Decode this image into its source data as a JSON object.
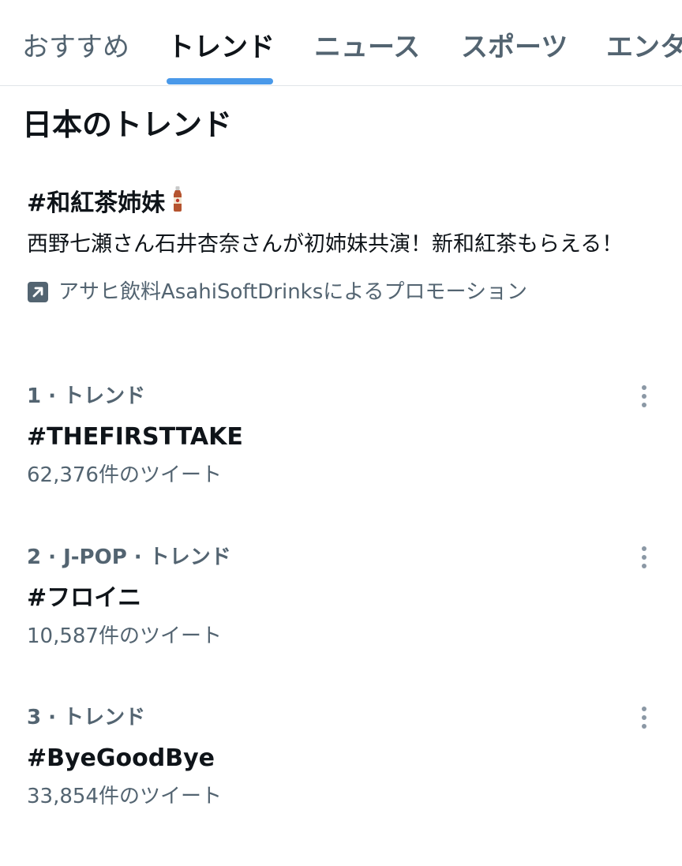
{
  "tabs": [
    {
      "label": "おすすめ"
    },
    {
      "label": "トレンド"
    },
    {
      "label": "ニュース"
    },
    {
      "label": "スポーツ"
    },
    {
      "label": "エンタ"
    }
  ],
  "active_tab": "トレンド",
  "section": {
    "title": "日本のトレンド"
  },
  "promo": {
    "title": "#和紅茶姉妹",
    "icon": "tea-bottle-icon",
    "description": "西野七瀬さん石井杏奈さんが初姉妹共演！新和紅茶もらえる！",
    "promoted_by": "アサヒ飲料AsahiSoftDrinksによるプロモーション",
    "promoted_icon": "promoted-arrow-icon"
  },
  "trends": [
    {
      "meta": "1 · トレンド",
      "name": "#THEFIRSTTAKE",
      "count": "62,376件のツイート"
    },
    {
      "meta": "2 · J-POP · トレンド",
      "name": "#フロイニ",
      "count": "10,587件のツイート"
    },
    {
      "meta": "3 · トレンド",
      "name": "#ByeGoodBye",
      "count": "33,854件のツイート"
    }
  ],
  "colors": {
    "accent": "#4a99e9",
    "text_primary": "#0f1419",
    "text_secondary": "#536471"
  }
}
